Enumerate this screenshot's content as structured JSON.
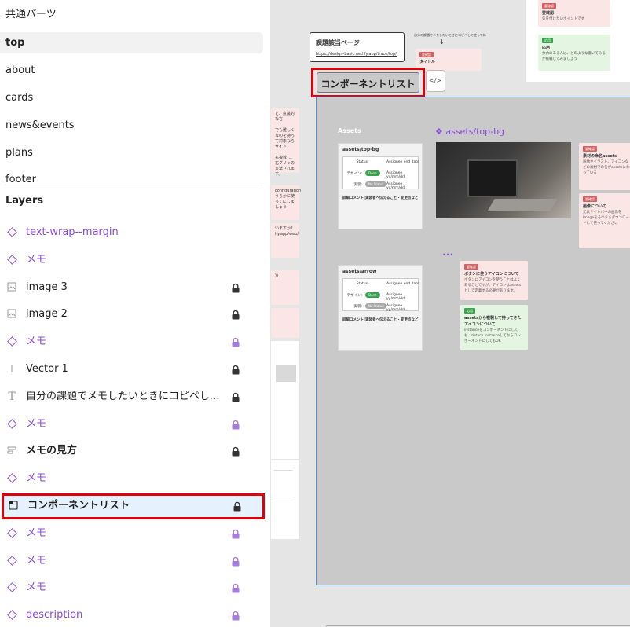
{
  "pages": [
    {
      "label": "共通パーツ",
      "selected": false
    },
    {
      "label": "top",
      "selected": true
    },
    {
      "label": "about",
      "selected": false
    },
    {
      "label": "cards",
      "selected": false
    },
    {
      "label": "news&events",
      "selected": false
    },
    {
      "label": "plans",
      "selected": false
    },
    {
      "label": "footer",
      "selected": false
    }
  ],
  "layers_title": "Layers",
  "layers": [
    {
      "label": "text-wrap--margin",
      "icon": "component-instance-icon",
      "color": "#8b4cd8",
      "locked": false,
      "bold": false
    },
    {
      "label": "メモ",
      "icon": "component-instance-icon",
      "color": "#8b4cd8",
      "locked": false,
      "bold": false
    },
    {
      "label": "image 3",
      "icon": "image-icon",
      "color": "#222222",
      "locked": true,
      "bold": false
    },
    {
      "label": "image 2",
      "icon": "image-icon",
      "color": "#222222",
      "locked": true,
      "bold": false
    },
    {
      "label": "メモ",
      "icon": "component-instance-icon",
      "color": "#8b4cd8",
      "locked": true,
      "bold": false
    },
    {
      "label": "Vector 1",
      "icon": "vector-line-icon",
      "color": "#222222",
      "locked": true,
      "bold": false
    },
    {
      "label": "自分の課題でメモしたいときにコピペして使...",
      "icon": "text-icon",
      "color": "#222222",
      "locked": true,
      "bold": false
    },
    {
      "label": "メモ",
      "icon": "component-instance-icon",
      "color": "#8b4cd8",
      "locked": true,
      "bold": false
    },
    {
      "label": "メモの見方",
      "icon": "auto-layout-icon",
      "color": "#222222",
      "locked": true,
      "bold": true
    },
    {
      "label": "メモ",
      "icon": "component-instance-icon",
      "color": "#8b4cd8",
      "locked": false,
      "bold": false
    },
    {
      "label": "コンポーネントリスト",
      "icon": "section-icon",
      "color": "#222222",
      "locked": true,
      "bold": true,
      "selected": true
    },
    {
      "label": "メモ",
      "icon": "component-instance-icon",
      "color": "#8b4cd8",
      "locked": true,
      "bold": false
    },
    {
      "label": "メモ",
      "icon": "component-instance-icon",
      "color": "#8b4cd8",
      "locked": true,
      "bold": false
    },
    {
      "label": "メモ",
      "icon": "component-instance-icon",
      "color": "#8b4cd8",
      "locked": true,
      "bold": false
    },
    {
      "label": "description",
      "icon": "component-instance-icon",
      "color": "#8b4cd8",
      "locked": true,
      "bold": false
    }
  ],
  "colors": {
    "highlight": "#e0000a",
    "component": "#8b4cd8",
    "section_border": "#5a8fd6",
    "selection_bg": "#e5f2fd"
  },
  "canvas": {
    "task_page_title": "課題該当ページ",
    "task_page_url": "https://design-basic.netlify.app/trace/top/",
    "arrow_note": "自分の課題でメモしたいときにコピペして使ってね",
    "component_list_button": "コンポーネントリスト",
    "code_icon_glyph": "</>",
    "top_note_tag": "要確認",
    "top_note_title": "要確認",
    "top_note_body": "気を付けたいポイントです",
    "top_green_tag": "応用",
    "top_green_title": "応用",
    "top_green_body": "余力のある人は、どのような書いてみるか挑戦してみましょう",
    "small_note_tag": "要確認",
    "small_note_title": "タイトル",
    "section_title": "Assets",
    "asset_main_label": "❖ assets/top-bg",
    "asset_cards": [
      {
        "title": "assets/top-bg",
        "status_label": "Status",
        "assignee_label": "Assignee end date",
        "design_label": "デザイン:",
        "design_status": "Done",
        "design_assignee": "Assignee yy/mm/dd",
        "impl_label": "実装:",
        "impl_status": "No Status",
        "impl_assignee": "Assignee yy/mm/dd",
        "comment": "詳細コメント(実装者へ伝えること・変更点など)"
      },
      {
        "title": "assets/arrow",
        "status_label": "Status",
        "assignee_label": "Assignee end date",
        "design_label": "デザイン:",
        "design_status": "Done",
        "design_assignee": "Assignee yy/mm/dd",
        "impl_label": "実装:",
        "impl_status": "No Status",
        "impl_assignee": "Assignee yy/mm/dd",
        "comment": "詳細コメント(実装者へ伝えること・変更点など)"
      }
    ],
    "notes": [
      {
        "tag": "要確認",
        "title": "素材の命名assets",
        "body": "画像やイラスト、アイコンなどの素材で命名がassetsになっている"
      },
      {
        "tag": "要確認",
        "title": "画像について",
        "body": "元素サイトバーの画像をImageをそのままダウンロードして使ってください"
      },
      {
        "tag": "要確認",
        "title": "ボタンに使うアイコンについて",
        "body": "ボタンにアイコンを使うことはよくあることですが、アイコンはassetsとして定義する必要があります。"
      },
      {
        "tag": "応用",
        "title": "assetsから複製して持ってきたアイコンについて",
        "body": "instanceをコンポーネントにしても、detach instanceしてからコンポーネントにしてもOK"
      }
    ],
    "left_strip_texts": [
      "と、意識的な言",
      "でも難しくなのを持って対象ならサイト",
      "も複数し、右グリッの方法されます。",
      "configuration",
      "うらかに使ってにしましょう",
      "いますか？",
      "ify.app/web/",
      "))"
    ]
  }
}
